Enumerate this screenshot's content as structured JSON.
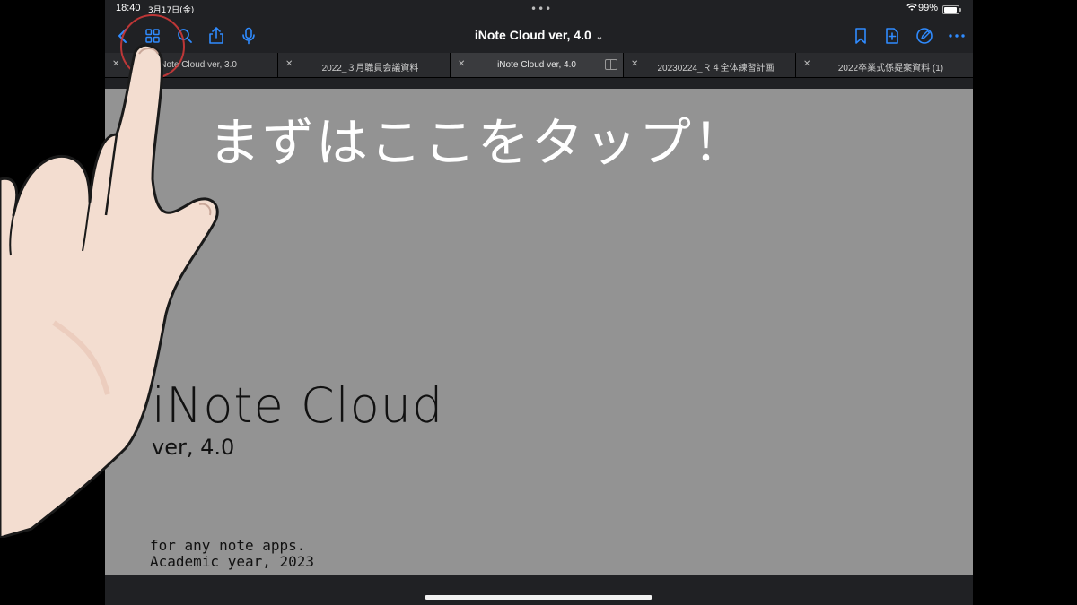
{
  "status_bar": {
    "time": "18:40",
    "date": "3月17日(金)",
    "battery": "99%"
  },
  "toolbar": {
    "title": "iNote Cloud ver, 4.0",
    "icons": [
      "back-icon",
      "grid-icon",
      "search-icon",
      "share-icon",
      "microphone-icon",
      "bookmark-icon",
      "add-page-icon",
      "pencil-icon",
      "more-icon"
    ],
    "accent": "#2f8bff"
  },
  "tabs": [
    {
      "label": "iNote Cloud ver, 3.0"
    },
    {
      "label": "2022_３月職員会議資料"
    },
    {
      "label": "iNote Cloud ver, 4.0"
    },
    {
      "label": "20230224_Ｒ４全体練習計画"
    },
    {
      "label": "2022卒業式係提案資料 (1)"
    }
  ],
  "page": {
    "caption": "まずはここをタップ！",
    "title": "iNote Cloud",
    "version": "ver, 4.0",
    "line1": "for any note apps.",
    "line2": "Academic year, 2023",
    "background": "#939393"
  },
  "highlight_color": "#d83a3a"
}
